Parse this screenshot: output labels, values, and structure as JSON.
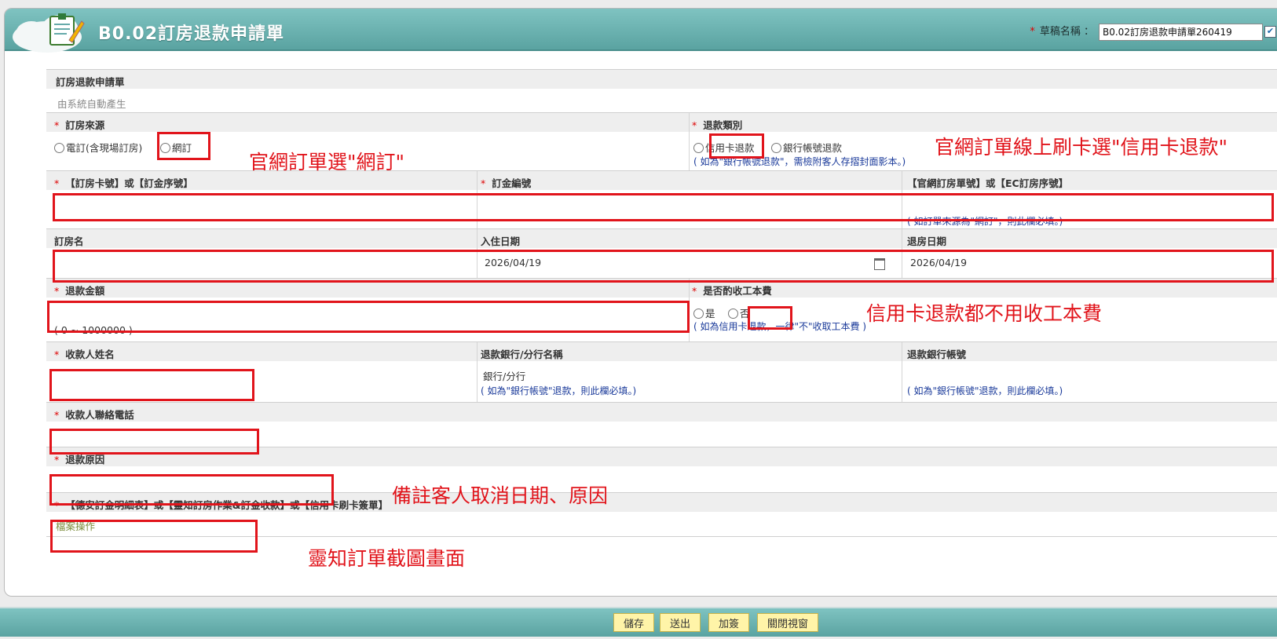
{
  "header": {
    "title": "B0.02訂房退款申請單",
    "draft_label": "草稿名稱 ：",
    "draft_value": "B0.02訂房退款申請單260419"
  },
  "form": {
    "section_title": "訂房退款申請單",
    "auto_text": "由系統自動產生",
    "booking_source": {
      "label": "訂房來源",
      "options": [
        "電訂(含現場訂房)",
        "網訂"
      ]
    },
    "refund_type": {
      "label": "退款類別",
      "options": [
        "信用卡退款",
        "銀行帳號退款"
      ],
      "hint": "( 如為\"銀行帳號退款\"，需檢附客人存摺封面影本。)"
    },
    "card_no_label": "【訂房卡號】或【訂金序號】",
    "deposit_no_label": "訂金編號",
    "web_order_label": "【官網訂房單號】或【EC訂房序號】",
    "web_order_hint": "( 如訂單來源為\"網訂\"，則此欄必填。)",
    "guest_name_label": "訂房名",
    "checkin_label": "入住日期",
    "checkin_value": "2026/04/19",
    "checkout_label": "退房日期",
    "checkout_value": "2026/04/19",
    "refund_amount_label": "退款金額",
    "refund_amount_range": "( 0 ~ 1000000 )",
    "fee": {
      "label": "是否酌收工本費",
      "options": [
        "是",
        "否"
      ],
      "hint": "( 如為信用卡退款，一律\"不\"收取工本費 )"
    },
    "payee_name_label": "收款人姓名",
    "bank_branch_label": "退款銀行/分行名稱",
    "bank_branch_value": "銀行/分行",
    "bank_branch_hint": "( 如為\"銀行帳號\"退款，則此欄必填。)",
    "bank_account_label": "退款銀行帳號",
    "bank_account_hint": "( 如為\"銀行帳號\"退款，則此欄必填。)",
    "payee_phone_label": "收款人聯絡電話",
    "refund_reason_label": "退款原因",
    "attachment_label": "【德安訂金明細表】或【靈知訂房作業&訂金收款】或【信用卡刷卡簽單】",
    "file_op": "檔案操作"
  },
  "annotations": {
    "web_order": "官網訂單選\"網訂\"",
    "credit_card": "官網訂單線上刷卡選\"信用卡退款\"",
    "no_fee": "信用卡退款都不用收工本費",
    "reason_note": "備註客人取消日期、原因",
    "screenshot_note": "靈知訂單截圖畫面"
  },
  "footer": {
    "buttons": [
      "儲存",
      "送出",
      "加簽",
      "關閉視窗"
    ]
  },
  "colors": {
    "header": "#5aa3a1",
    "annotation": "#e1141b",
    "button": "#fff4a8"
  }
}
